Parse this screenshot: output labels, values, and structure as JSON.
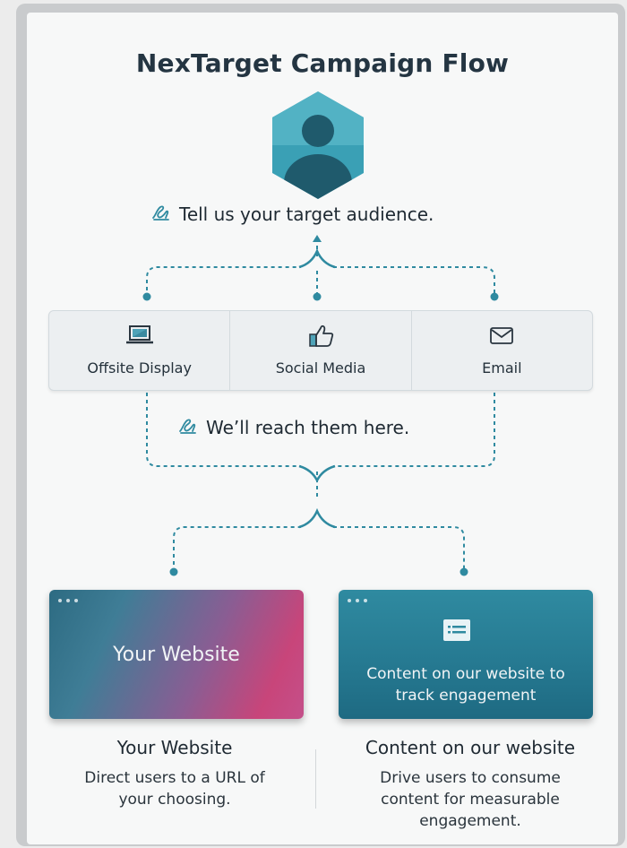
{
  "title": "NexTarget Campaign Flow",
  "audience_prompt": "Tell us your target audience.",
  "channels": [
    {
      "label": "Offsite Display",
      "icon": "laptop-icon"
    },
    {
      "label": "Social Media",
      "icon": "thumbs-up-icon"
    },
    {
      "label": "Email",
      "icon": "envelope-icon"
    }
  ],
  "reach_prompt": "We’ll reach them here.",
  "destinations": [
    {
      "card_text": "Your Website",
      "heading": "Your Website",
      "description": "Direct users to a URL of your choosing."
    },
    {
      "card_text": "Content on our website to track engagement",
      "heading": "Content on our website",
      "description": "Drive users to consume content for measurable engagement."
    }
  ],
  "colors": {
    "title": "#243542",
    "connector": "#2f8aa0",
    "avatar": "#2f8aa0"
  }
}
